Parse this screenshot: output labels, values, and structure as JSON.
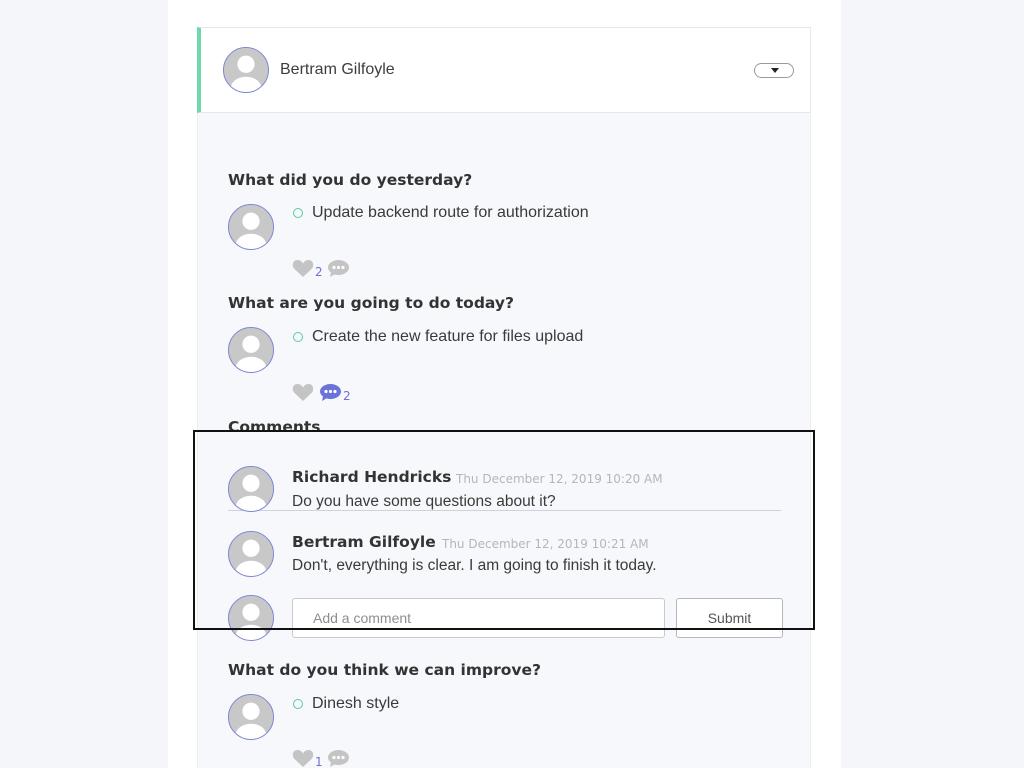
{
  "header": {
    "user_name": "Bertram Gilfoyle"
  },
  "sections": {
    "yesterday": {
      "title": "What did you do yesterday?",
      "item": "Update backend route for authorization",
      "likes": "2",
      "comments": ""
    },
    "today": {
      "title": "What are you going to do today?",
      "item": "Create the new feature for files upload",
      "likes": "",
      "comments": "2"
    },
    "comments": {
      "title": "Comments",
      "entries": [
        {
          "author": "Richard Hendricks",
          "time": "Thu December 12, 2019 10:20 AM",
          "text": "Do you have some questions about it?"
        },
        {
          "author": "Bertram Gilfoyle",
          "time": "Thu December 12, 2019 10:21 AM",
          "text": "Don't, everything is clear. I am going to finish it today."
        }
      ],
      "input_placeholder": "Add a comment",
      "input_value": "",
      "submit_label": "Submit"
    },
    "improve": {
      "title": "What do you think we can improve?",
      "item": "Dinesh style",
      "likes": "1",
      "comments": ""
    }
  },
  "icons": {
    "avatar": "user-avatar-icon",
    "dropdown": "chevron-down-icon",
    "like": "heart-icon",
    "comment": "speech-bubble-icon",
    "bullet": "circle-bullet-icon"
  },
  "colors": {
    "accent_green": "#6fd6ae",
    "accent_purple": "#6b72d9",
    "avatar_border": "#7b86d6",
    "icon_gray": "#c4c4c4"
  }
}
